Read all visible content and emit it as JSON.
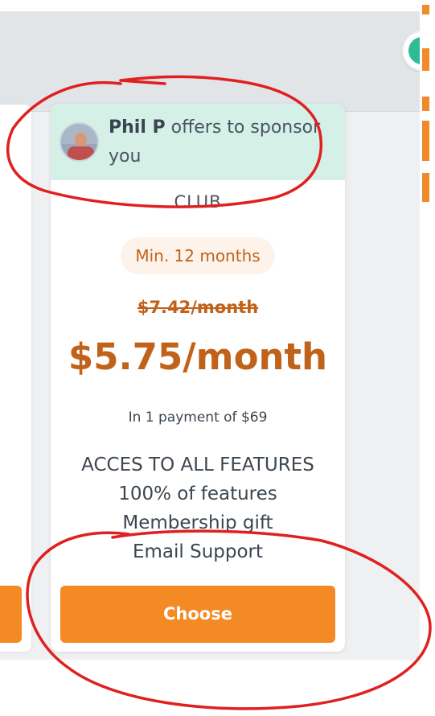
{
  "sponsor": {
    "name": "Phil P",
    "message": "offers to sponsor you"
  },
  "plan": {
    "name": "CLUB",
    "min_duration": "Min. 12 months",
    "old_price": "$7.42/month",
    "price": "$5.75/month",
    "payment_note": "In 1 payment of $69",
    "features": [
      "ACCES TO ALL FEATURES",
      "100% of features",
      "Membership gift",
      "Email Support"
    ],
    "cta_label": "Choose"
  },
  "colors": {
    "accent": "#f48a24",
    "price_text": "#c0621a",
    "sponsor_banner": "#d5f0e7",
    "annotation": "#e02020"
  },
  "icons": {
    "sponsor_avatar": "user-photo",
    "account_avatar": "avatar-circle"
  }
}
